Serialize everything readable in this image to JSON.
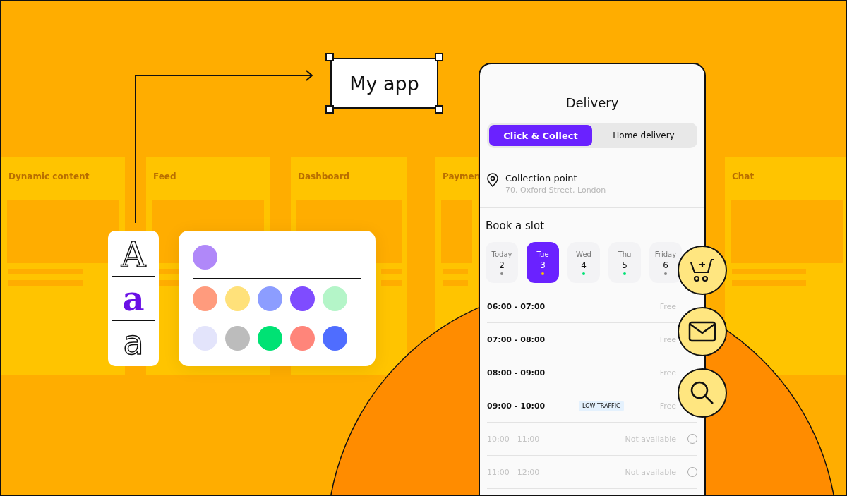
{
  "background_cards": [
    {
      "title": "Dynamic content"
    },
    {
      "title": "Feed"
    },
    {
      "title": "Dashboard"
    },
    {
      "title": "Paymen"
    },
    {
      "title": "Chat"
    }
  ],
  "label_box": {
    "text": "My app"
  },
  "font_samples": [
    {
      "glyph": "A",
      "kind": "outline-serif"
    },
    {
      "glyph": "a",
      "kind": "bold-serif"
    },
    {
      "glyph": "a",
      "kind": "outline-sans"
    }
  ],
  "palette": {
    "current": {
      "color": "#b088f9"
    },
    "swatches": [
      {
        "color": "#ff9b7d"
      },
      {
        "color": "#ffe17a"
      },
      {
        "color": "#8c9dff"
      },
      {
        "color": "#7f4cff"
      },
      {
        "color": "#b4f5c8"
      },
      {
        "color": "#e3e4fb"
      },
      {
        "color": "#bcbcbc"
      },
      {
        "color": "#00e274"
      },
      {
        "color": "#ff857a"
      },
      {
        "color": "#4f6dff"
      }
    ]
  },
  "phone": {
    "title": "Delivery",
    "tabs": [
      {
        "label": "Click & Collect",
        "selected": true
      },
      {
        "label": "Home delivery",
        "selected": false
      }
    ],
    "collection": {
      "label": "Collection point",
      "address": "70, Oxford Street, London"
    },
    "slot_heading": "Book a slot",
    "days": [
      {
        "name": "Today",
        "date": "2",
        "selected": false,
        "color": "#888888"
      },
      {
        "name": "Tue",
        "date": "3",
        "selected": true,
        "color": "#ffc400"
      },
      {
        "name": "Wed",
        "date": "4",
        "selected": false,
        "color": "#00e274"
      },
      {
        "name": "Thu",
        "date": "5",
        "selected": false,
        "color": "#00e274"
      },
      {
        "name": "Friday",
        "date": "6",
        "selected": false,
        "color": "#888888"
      }
    ],
    "slots": [
      {
        "time": "06:00 - 07:00",
        "status": "Free",
        "disabled": false
      },
      {
        "time": "07:00 - 08:00",
        "status": "Free",
        "disabled": false
      },
      {
        "time": "08:00 - 09:00",
        "status": "Free",
        "disabled": false
      },
      {
        "time": "09:00 - 10:00",
        "tag": "LOW TRAFFIC",
        "status": "Free",
        "disabled": false
      },
      {
        "time": "10:00 - 11:00",
        "status": "Not available",
        "disabled": true,
        "selected": false
      },
      {
        "time": "11:00 - 12:00",
        "status": "Not available",
        "disabled": true,
        "selected": false
      }
    ]
  },
  "floating_buttons": [
    {
      "kind": "cart"
    },
    {
      "kind": "mail"
    },
    {
      "kind": "search"
    }
  ]
}
